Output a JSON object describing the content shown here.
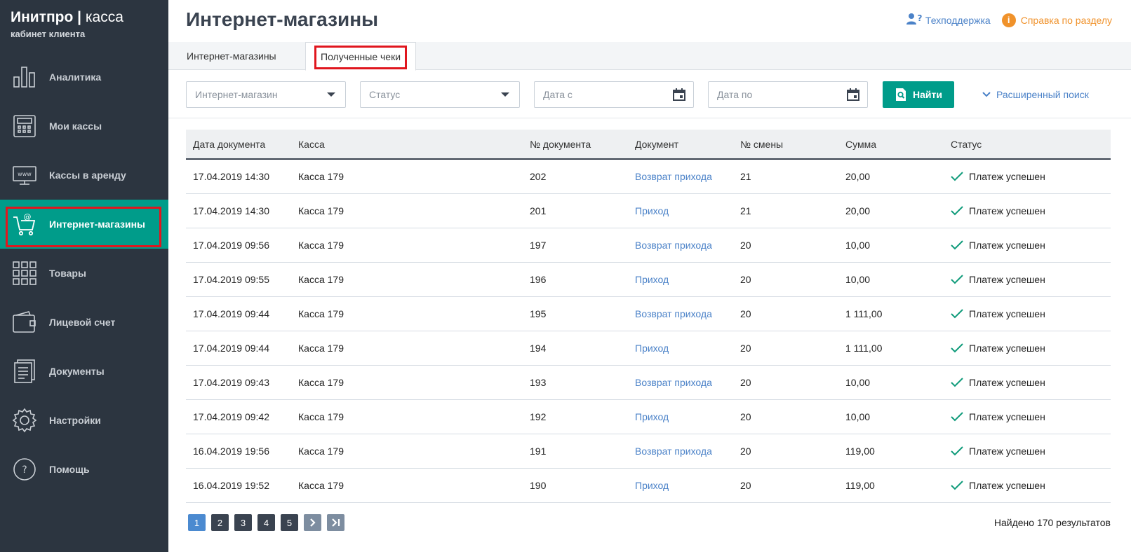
{
  "brand": {
    "name": "Инитпро",
    "separator": "|",
    "product": "касса",
    "subtitle": "кабинет клиента"
  },
  "sidebar": {
    "items": [
      {
        "label": "Аналитика",
        "icon": "analytics-icon"
      },
      {
        "label": "Мои кассы",
        "icon": "cash-register-icon"
      },
      {
        "label": "Кассы в аренду",
        "icon": "www-monitor-icon"
      },
      {
        "label": "Интернет-магазины",
        "icon": "shopping-cart-icon",
        "active": true
      },
      {
        "label": "Товары",
        "icon": "grid-icon"
      },
      {
        "label": "Лицевой счет",
        "icon": "wallet-icon"
      },
      {
        "label": "Документы",
        "icon": "document-icon"
      },
      {
        "label": "Настройки",
        "icon": "gear-icon"
      },
      {
        "label": "Помощь",
        "icon": "question-circle-icon"
      }
    ]
  },
  "header": {
    "title": "Интернет-магазины",
    "support_link": "Техподдержка",
    "help_link": "Справка по разделу"
  },
  "tabs": [
    {
      "label": "Интернет-магазины"
    },
    {
      "label": "Полученные чеки",
      "active": true
    }
  ],
  "filters": {
    "shop_placeholder": "Интернет-магазин",
    "status_placeholder": "Статус",
    "date_from_placeholder": "Дата с",
    "date_to_placeholder": "Дата по",
    "find_label": "Найти",
    "advanced_label": "Расширенный поиск"
  },
  "table": {
    "headers": [
      "Дата документа",
      "Касса",
      "№ документа",
      "Документ",
      "№ смены",
      "Сумма",
      "Статус"
    ],
    "rows": [
      [
        "17.04.2019 14:30",
        "Касса 179",
        "202",
        "Возврат прихода",
        "21",
        "20,00",
        "Платеж успешен"
      ],
      [
        "17.04.2019 14:30",
        "Касса 179",
        "201",
        "Приход",
        "21",
        "20,00",
        "Платеж успешен"
      ],
      [
        "17.04.2019 09:56",
        "Касса 179",
        "197",
        "Возврат прихода",
        "20",
        "10,00",
        "Платеж успешен"
      ],
      [
        "17.04.2019 09:55",
        "Касса 179",
        "196",
        "Приход",
        "20",
        "10,00",
        "Платеж успешен"
      ],
      [
        "17.04.2019 09:44",
        "Касса 179",
        "195",
        "Возврат прихода",
        "20",
        "1 111,00",
        "Платеж успешен"
      ],
      [
        "17.04.2019 09:44",
        "Касса 179",
        "194",
        "Приход",
        "20",
        "1 111,00",
        "Платеж успешен"
      ],
      [
        "17.04.2019 09:43",
        "Касса 179",
        "193",
        "Возврат прихода",
        "20",
        "10,00",
        "Платеж успешен"
      ],
      [
        "17.04.2019 09:42",
        "Касса 179",
        "192",
        "Приход",
        "20",
        "10,00",
        "Платеж успешен"
      ],
      [
        "16.04.2019 19:56",
        "Касса 179",
        "191",
        "Возврат прихода",
        "20",
        "119,00",
        "Платеж успешен"
      ],
      [
        "16.04.2019 19:52",
        "Касса 179",
        "190",
        "Приход",
        "20",
        "119,00",
        "Платеж успешен"
      ]
    ]
  },
  "pagination": {
    "pages": [
      "1",
      "2",
      "3",
      "4",
      "5"
    ],
    "current": "1",
    "next_icon": "chevron-right-icon",
    "last_icon": "last-page-icon"
  },
  "results_text": "Найдено 170 результатов",
  "colors": {
    "sidebar": "#2c3540",
    "accent": "#009c8a",
    "link": "#4b82c8",
    "help": "#f0922b",
    "highlight": "#e0161e"
  }
}
